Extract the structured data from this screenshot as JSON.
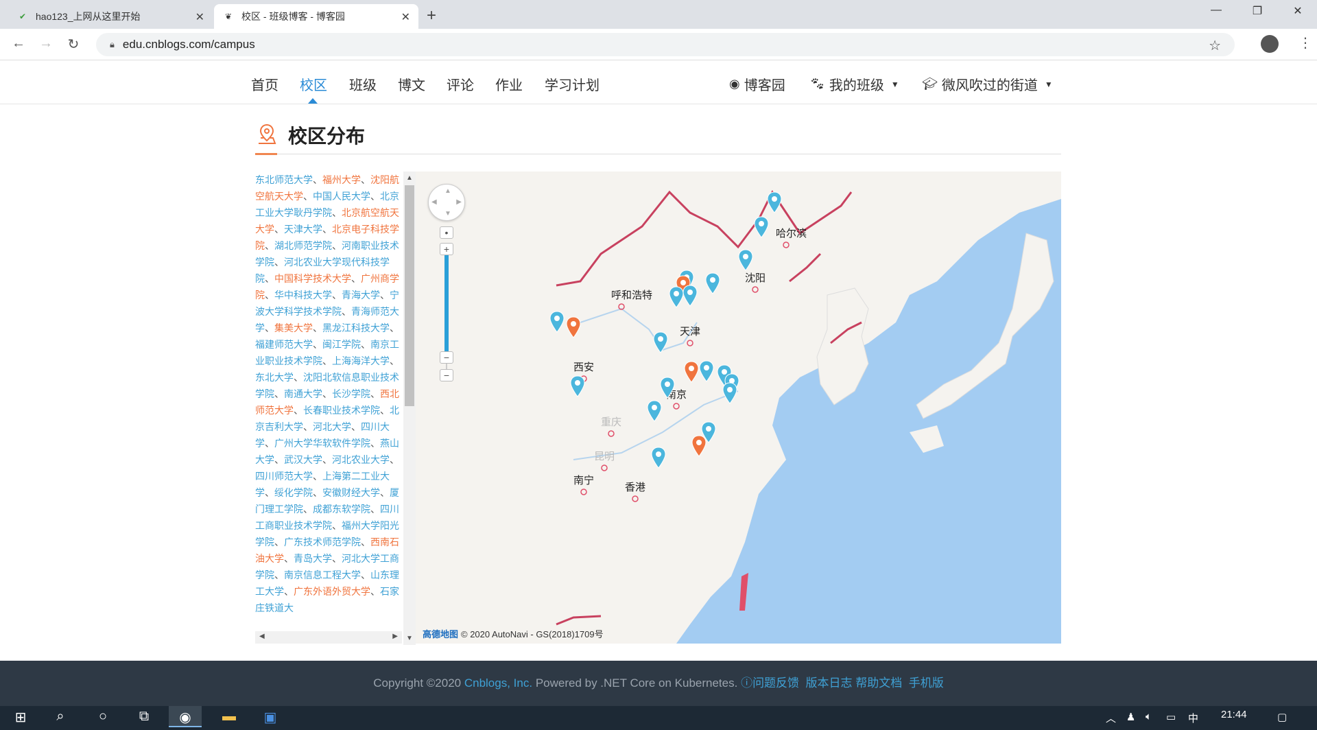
{
  "browser": {
    "tabs": [
      {
        "title": "hao123_上网从这里开始",
        "active": false
      },
      {
        "title": "校区 - 班级博客 - 博客园",
        "active": true
      }
    ],
    "url": "edu.cnblogs.com/campus"
  },
  "nav": {
    "items": [
      "首页",
      "校区",
      "班级",
      "博文",
      "评论",
      "作业",
      "学习计划"
    ],
    "active": "校区",
    "right": {
      "cnblogs": "博客园",
      "my_class": "我的班级",
      "user": "微风吹过的街道"
    }
  },
  "page": {
    "title": "校区分布"
  },
  "schools": [
    {
      "name": "东北师范大学",
      "color": "blue"
    },
    {
      "name": "福州大学",
      "color": "orange"
    },
    {
      "name": "沈阳航空航天大学",
      "color": "orange"
    },
    {
      "name": "中国人民大学",
      "color": "blue"
    },
    {
      "name": "北京工业大学耿丹学院",
      "color": "blue"
    },
    {
      "name": "北京航空航天大学",
      "color": "orange"
    },
    {
      "name": "天津大学",
      "color": "blue"
    },
    {
      "name": "北京电子科技学院",
      "color": "orange"
    },
    {
      "name": "湖北师范学院",
      "color": "blue"
    },
    {
      "name": "河南职业技术学院",
      "color": "blue"
    },
    {
      "name": "河北农业大学现代科技学院",
      "color": "blue"
    },
    {
      "name": "中国科学技术大学",
      "color": "orange"
    },
    {
      "name": "广州商学院",
      "color": "orange"
    },
    {
      "name": "华中科技大学",
      "color": "blue"
    },
    {
      "name": "青海大学",
      "color": "blue"
    },
    {
      "name": "宁波大学科学技术学院",
      "color": "blue"
    },
    {
      "name": "青海师范大学",
      "color": "blue"
    },
    {
      "name": "集美大学",
      "color": "orange"
    },
    {
      "name": "黑龙江科技大学",
      "color": "blue"
    },
    {
      "name": "福建师范大学",
      "color": "blue"
    },
    {
      "name": "闽江学院",
      "color": "blue"
    },
    {
      "name": "南京工业职业技术学院",
      "color": "blue"
    },
    {
      "name": "上海海洋大学",
      "color": "blue"
    },
    {
      "name": "东北大学",
      "color": "blue"
    },
    {
      "name": "沈阳北软信息职业技术学院",
      "color": "blue"
    },
    {
      "name": "南通大学",
      "color": "blue"
    },
    {
      "name": "长沙学院",
      "color": "blue"
    },
    {
      "name": "西北师范大学",
      "color": "orange"
    },
    {
      "name": "长春职业技术学院",
      "color": "blue"
    },
    {
      "name": "北京吉利大学",
      "color": "blue"
    },
    {
      "name": "河北大学",
      "color": "blue"
    },
    {
      "name": "四川大学",
      "color": "blue"
    },
    {
      "name": "广州大学华软软件学院",
      "color": "blue"
    },
    {
      "name": "燕山大学",
      "color": "blue"
    },
    {
      "name": "武汉大学",
      "color": "blue"
    },
    {
      "name": "河北农业大学",
      "color": "blue"
    },
    {
      "name": "四川师范大学",
      "color": "blue"
    },
    {
      "name": "上海第二工业大学",
      "color": "blue"
    },
    {
      "name": "绥化学院",
      "color": "blue"
    },
    {
      "name": "安徽财经大学",
      "color": "blue"
    },
    {
      "name": "厦门理工学院",
      "color": "blue"
    },
    {
      "name": "成都东软学院",
      "color": "blue"
    },
    {
      "name": "四川工商职业技术学院",
      "color": "blue"
    },
    {
      "name": "福州大学阳光学院",
      "color": "blue"
    },
    {
      "name": "广东技术师范学院",
      "color": "blue"
    },
    {
      "name": "西南石油大学",
      "color": "orange"
    },
    {
      "name": "青岛大学",
      "color": "blue"
    },
    {
      "name": "河北大学工商学院",
      "color": "blue"
    },
    {
      "name": "南京信息工程大学",
      "color": "blue"
    },
    {
      "name": "山东理工大学",
      "color": "blue"
    },
    {
      "name": "广东外语外贸大学",
      "color": "orange"
    },
    {
      "name": "石家庄铁道大",
      "color": "blue"
    }
  ],
  "map": {
    "cities": [
      "哈尔滨",
      "沈阳",
      "呼和浩特",
      "天津",
      "西安",
      "南京",
      "南宁",
      "香港",
      "重庆",
      "昆明"
    ],
    "attribution": "© 2020 AutoNavi - GS(2018)1709号",
    "logo_text": "高德地图",
    "colors": {
      "land": "#f5f3ef",
      "sea": "#a3ccf2",
      "border": "#c8415f",
      "blue_pin": "#4bb6dd",
      "orange_pin": "#f0743e"
    }
  },
  "footer": {
    "copyright": "Copyright ©2020",
    "company": "Cnblogs, Inc.",
    "powered": "Powered by .NET Core on Kubernetes.",
    "links": [
      "问题反馈",
      "版本日志",
      "帮助文档",
      "手机版"
    ]
  },
  "taskbar": {
    "time": "21:44",
    "ime": "中"
  }
}
